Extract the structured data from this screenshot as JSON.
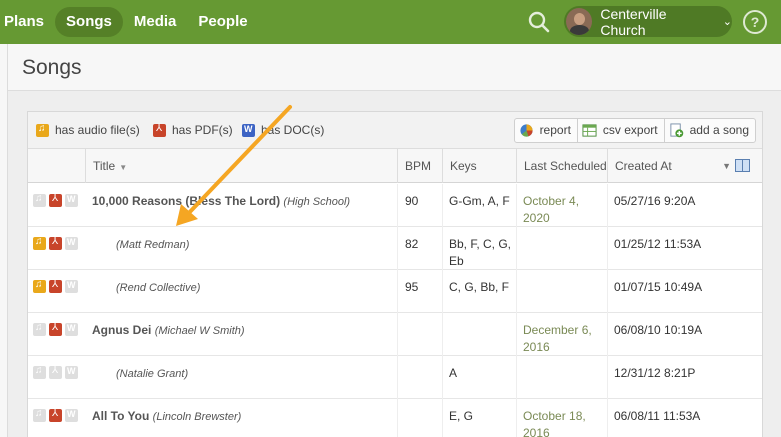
{
  "nav": {
    "items": [
      {
        "label": "Plans",
        "active": false
      },
      {
        "label": "Songs",
        "active": true
      },
      {
        "label": "Media",
        "active": false
      },
      {
        "label": "People",
        "active": false
      }
    ],
    "org_name": "Centerville Church",
    "search_icon": "search-icon",
    "help_label": "?",
    "colors": {
      "bar": "#669933",
      "active": "#558027"
    }
  },
  "page": {
    "title": "Songs"
  },
  "legend": {
    "audio": "has audio file(s)",
    "pdf": "has PDF(s)",
    "doc": "has DOC(s)"
  },
  "toolbar": {
    "report": "report",
    "csv": "csv export",
    "add": "add a song"
  },
  "table": {
    "headers": {
      "title": "Title",
      "bpm": "BPM",
      "keys": "Keys",
      "last": "Last Scheduled",
      "created": "Created At"
    },
    "rows": [
      {
        "title": "10,000 Reasons (Bless The Lord)",
        "artist": "(High School)",
        "indent": false,
        "bpm": "90",
        "keys": "G-Gm, A, F",
        "last": "October 4, 2020",
        "created": "05/27/16 9:20A",
        "audio": false,
        "pdf": true,
        "doc": false
      },
      {
        "title": "",
        "artist": "(Matt Redman)",
        "indent": true,
        "bpm": "82",
        "keys": "Bb, F, C, G, Eb",
        "last": "",
        "created": "01/25/12 11:53A",
        "audio": true,
        "pdf": true,
        "doc": false
      },
      {
        "title": "",
        "artist": "(Rend Collective)",
        "indent": true,
        "bpm": "95",
        "keys": "C, G, Bb, F",
        "last": "",
        "created": "01/07/15 10:49A",
        "audio": true,
        "pdf": true,
        "doc": false
      },
      {
        "title": "Agnus Dei",
        "artist": "(Michael W Smith)",
        "indent": false,
        "bpm": "",
        "keys": "",
        "last": "December 6, 2016",
        "created": "06/08/10 10:19A",
        "audio": false,
        "pdf": true,
        "doc": false
      },
      {
        "title": "",
        "artist": "(Natalie Grant)",
        "indent": true,
        "bpm": "",
        "keys": "A",
        "last": "",
        "created": "12/31/12 8:21P",
        "audio": false,
        "pdf": false,
        "doc": false
      },
      {
        "title": "All To You",
        "artist": "(Lincoln Brewster)",
        "indent": false,
        "bpm": "",
        "keys": "E, G",
        "last": "October 18, 2016",
        "created": "06/08/11 11:53A",
        "audio": false,
        "pdf": true,
        "doc": false
      }
    ]
  },
  "annotation": {
    "color": "#f5a623"
  }
}
